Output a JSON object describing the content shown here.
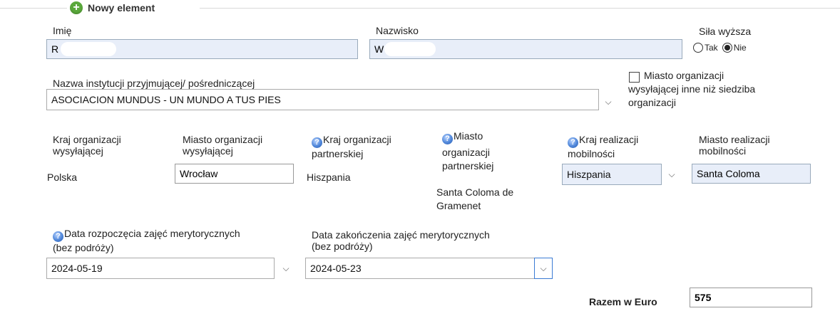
{
  "fieldset": {
    "legend": "Nowy element",
    "legend_icon": "plus-circle-icon"
  },
  "imie": {
    "label": "Imię",
    "value": "R"
  },
  "nazwisko": {
    "label": "Nazwisko",
    "value": "W"
  },
  "sila_wyzsza": {
    "label": "Siła wyższa",
    "options": [
      {
        "label": "Tak",
        "selected": false
      },
      {
        "label": "Nie",
        "selected": true
      }
    ]
  },
  "instytucja": {
    "label": "Nazwa instytucji przyjmującej/ pośredniczącej",
    "value": "ASOCIACION MUNDUS - UN MUNDO A TUS PIES"
  },
  "miasto_inne": {
    "label_lines": [
      "Miasto organizacji",
      "wysyłającej inne niż siedziba",
      "organizacji"
    ],
    "checked": false
  },
  "kraj_wysylajacej": {
    "label_lines": [
      "Kraj organizacji",
      "wysyłającej"
    ],
    "value": "Polska"
  },
  "miasto_wysylajacej": {
    "label_lines": [
      "Miasto organizacji",
      "wysyłającej"
    ],
    "value": "Wrocław"
  },
  "kraj_partnerskiej": {
    "label_lines": [
      "Kraj organizacji",
      "partnerskiej"
    ],
    "value": "Hiszpania"
  },
  "miasto_partnerskiej": {
    "label_lines": [
      "Miasto",
      "organizacji",
      "partnerskiej"
    ],
    "value_lines": [
      "Santa Coloma de",
      "Gramenet"
    ]
  },
  "kraj_realizacji": {
    "label_lines": [
      "Kraj realizacji",
      "mobilności"
    ],
    "value": "Hiszpania"
  },
  "miasto_realizacji": {
    "label_lines": [
      "Miasto realizacji",
      "mobilności"
    ],
    "value": "Santa Coloma"
  },
  "data_rozpoczecia": {
    "label_lines": [
      "Data rozpoczęcia zajęć merytorycznych",
      "(bez podróży)"
    ],
    "value": "2024-05-19"
  },
  "data_zakonczenia": {
    "label_lines": [
      "Data zakończenia zajęć merytorycznych",
      "(bez podróży)"
    ],
    "value": "2024-05-23"
  },
  "razem": {
    "label": "Razem w Euro",
    "value": "575"
  },
  "icons": {
    "chevron": "chevron-down-icon",
    "info": "info-icon"
  },
  "colors": {
    "input_bg": "#e8eef9",
    "legend_icon": "#5aa83b",
    "info_icon": "#4f86d9"
  }
}
